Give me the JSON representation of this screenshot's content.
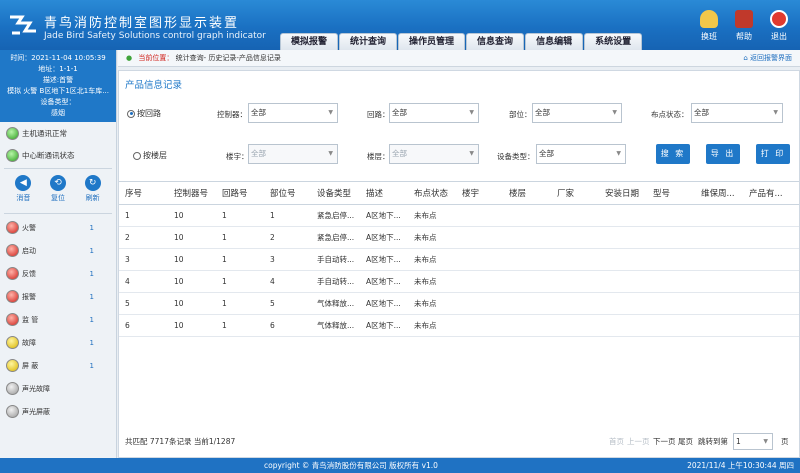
{
  "app": {
    "title_cn": "青鸟消防控制室图形显示装置",
    "title_en": "Jade Bird Safety Solutions control graph indicator"
  },
  "nav": [
    "模拟报警",
    "统计查询",
    "操作员管理",
    "信息查询",
    "信息编辑",
    "系统设置"
  ],
  "top_actions": [
    {
      "label": "换班",
      "icon": "person-icon"
    },
    {
      "label": "帮助",
      "icon": "book-icon"
    },
    {
      "label": "退出",
      "icon": "power-icon"
    }
  ],
  "info": {
    "time": "时间：2021-11-04 10:05:39",
    "address": "地址：1-1-1",
    "desc": "描述:首警",
    "location": "模拟 火警 B区地下1区北1车库...",
    "device_type": "设备类型：",
    "device_value": "感烟"
  },
  "connections": [
    {
      "label": "主机通讯正常",
      "color": "green"
    },
    {
      "label": "中心断通讯状态",
      "color": "green"
    }
  ],
  "tools": [
    {
      "label": "消音",
      "icon": "speaker-icon"
    },
    {
      "label": "复位",
      "icon": "reset-icon"
    },
    {
      "label": "刷新",
      "icon": "refresh-icon"
    }
  ],
  "statuses": [
    {
      "label": "火警",
      "color": "red",
      "count": "1"
    },
    {
      "label": "启动",
      "color": "red",
      "count": "1"
    },
    {
      "label": "反馈",
      "color": "red",
      "count": "1"
    },
    {
      "label": "报警",
      "color": "red",
      "count": "1"
    },
    {
      "label": "监 管",
      "color": "red",
      "count": "1"
    },
    {
      "label": "故障",
      "color": "yellow",
      "count": "1"
    },
    {
      "label": "屏 蔽",
      "color": "yellow",
      "count": "1"
    },
    {
      "label": "声光故障",
      "color": "gray",
      "count": ""
    },
    {
      "label": "声光屏蔽",
      "color": "gray",
      "count": ""
    }
  ],
  "breadcrumb": {
    "current_label": "当前位置：",
    "path": "统计查询- 历史记录-产品信息记录",
    "back": "返回报警界面"
  },
  "section_title": "产品信息记录",
  "form": {
    "radio_loop": "按回路",
    "radio_floor": "按楼层",
    "controller_label": "控制器：",
    "controller_value": "全部",
    "loop_label": "回路：",
    "loop_value": "全部",
    "part_label": "部位：",
    "part_value": "全部",
    "point_state_label": "布点状态：",
    "point_state_value": "全部",
    "building_label": "楼宇：",
    "building_value": "全部",
    "floor_label": "楼层：",
    "floor_value": "全部",
    "device_type_label": "设备类型：",
    "device_type_value": "全部",
    "search": "搜 索",
    "export": "导 出",
    "print": "打 印"
  },
  "table": {
    "headers": [
      "序号",
      "控制器号",
      "回路号",
      "部位号",
      "设备类型",
      "描述",
      "布点状态",
      "楼宇",
      "楼层",
      "厂家",
      "安装日期",
      "型号",
      "维保周...",
      "产品有..."
    ],
    "rows": [
      [
        "1",
        "10",
        "1",
        "1",
        "紧急启停...",
        "A区地下...",
        "未布点"
      ],
      [
        "2",
        "10",
        "1",
        "2",
        "紧急启停...",
        "A区地下...",
        "未布点"
      ],
      [
        "3",
        "10",
        "1",
        "3",
        "手自动转...",
        "A区地下...",
        "未布点"
      ],
      [
        "4",
        "10",
        "1",
        "4",
        "手自动转...",
        "A区地下...",
        "未布点"
      ],
      [
        "5",
        "10",
        "1",
        "5",
        "气体释放...",
        "A区地下...",
        "未布点"
      ],
      [
        "6",
        "10",
        "1",
        "6",
        "气体释放...",
        "A区地下...",
        "未布点"
      ]
    ]
  },
  "pager": {
    "summary": "共匹配 7717条记录  当前1/1287",
    "first": "首页",
    "prev": "上一页",
    "next": "下一页",
    "last": "尾页",
    "jump": "跳转到第",
    "page_value": "1",
    "page_unit": "页"
  },
  "footer": {
    "copyright": "copyright ©  青鸟消防股份有限公司 版权所有 v1.0",
    "datetime": "2021/11/4   上午10:30:44   周四"
  },
  "colors": {
    "header": "#1f78c8",
    "accent": "#1f78c8",
    "alarm": "#d0231c"
  }
}
